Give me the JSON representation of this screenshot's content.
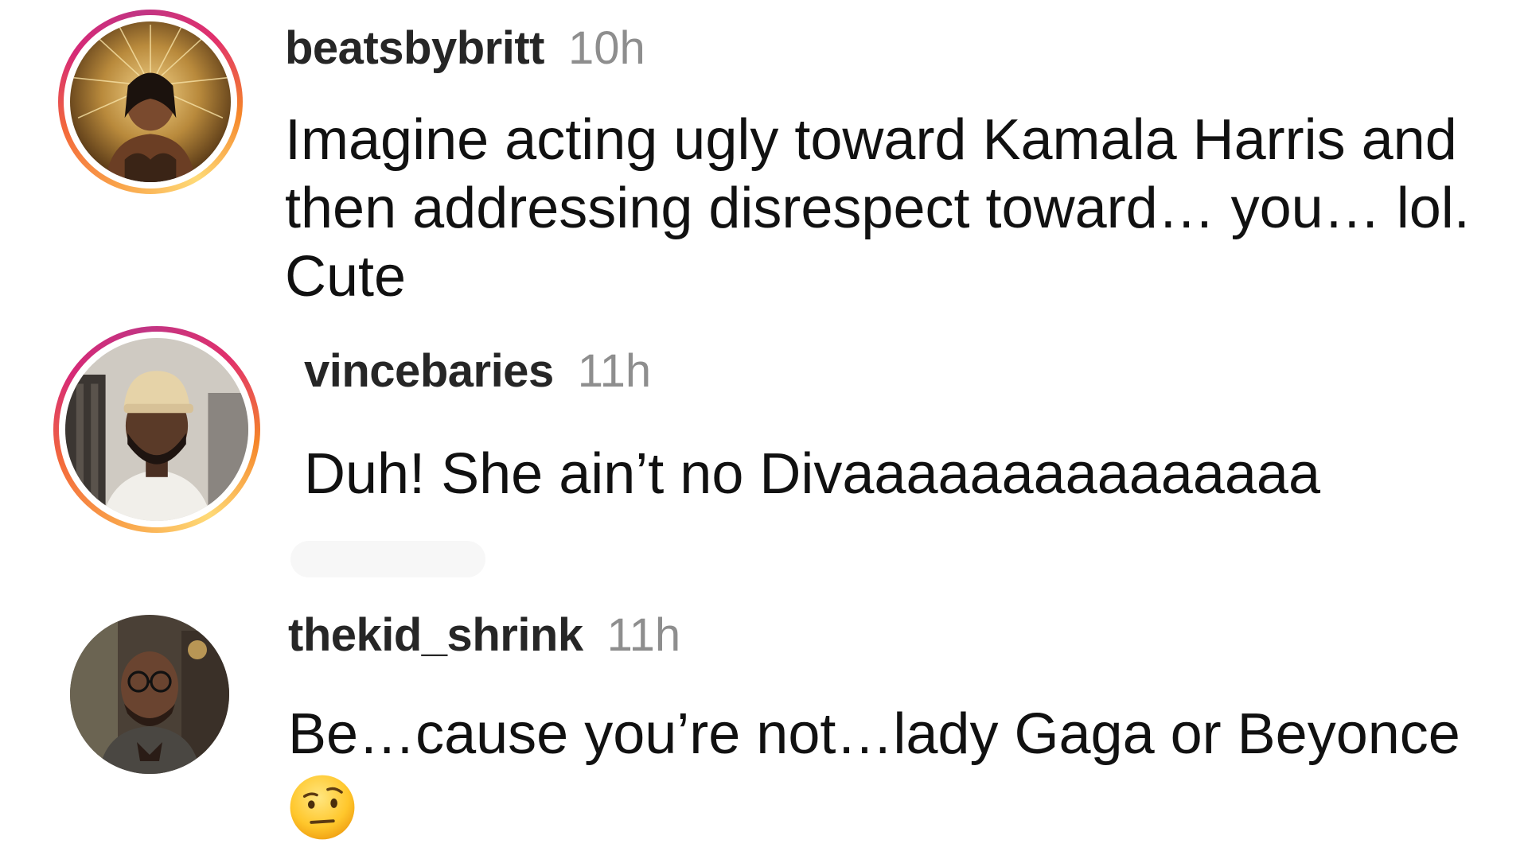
{
  "comments": [
    {
      "username": "beatsbybritt",
      "time": "10h",
      "text": "Imagine acting ugly toward Kamala Harris and\nthen addressing disrespect toward… you… lol.\nCute",
      "avatar_icon": "avatar-woman-golden-headpiece",
      "has_story_ring": true
    },
    {
      "username": "vincebaries",
      "time": "11h",
      "text": "Duh! She ain’t no Divaaaaaaaaaaaaaaa",
      "avatar_icon": "avatar-man-cap",
      "has_story_ring": true
    },
    {
      "username": "thekid_shrink",
      "time": "11h",
      "text": "Be…cause you’re not…lady Gaga or Beyonce",
      "avatar_icon": "avatar-man-glasses",
      "has_story_ring": false,
      "emoji": "face-with-raised-eyebrow"
    }
  ],
  "colors": {
    "username": "#262626",
    "timestamp": "#8e8e8e",
    "text": "#111111",
    "ring_start": "#f9a44a",
    "ring_end": "#d62976"
  }
}
